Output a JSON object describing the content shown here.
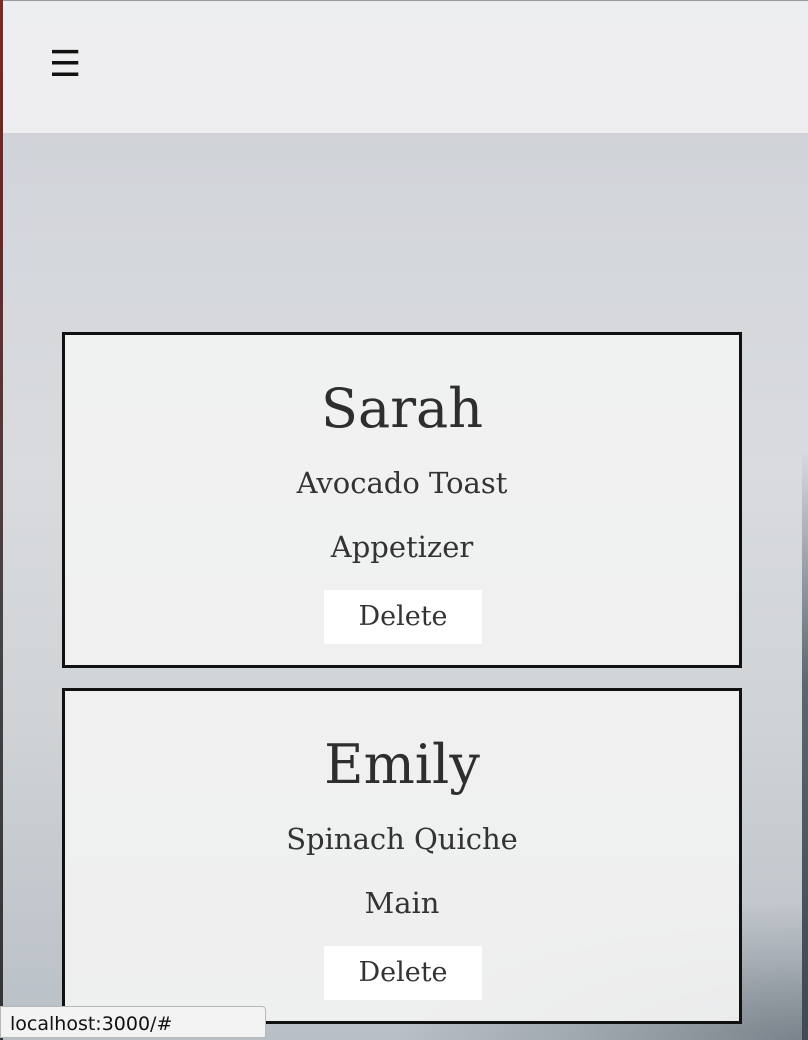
{
  "header": {
    "menu_icon": "☰"
  },
  "cards": [
    {
      "name": "Sarah",
      "dish": "Avocado Toast",
      "course": "Appetizer",
      "delete_label": "Delete"
    },
    {
      "name": "Emily",
      "dish": "Spinach Quiche",
      "course": "Main",
      "delete_label": "Delete"
    }
  ],
  "status_bar": {
    "url": "localhost:3000/#"
  }
}
